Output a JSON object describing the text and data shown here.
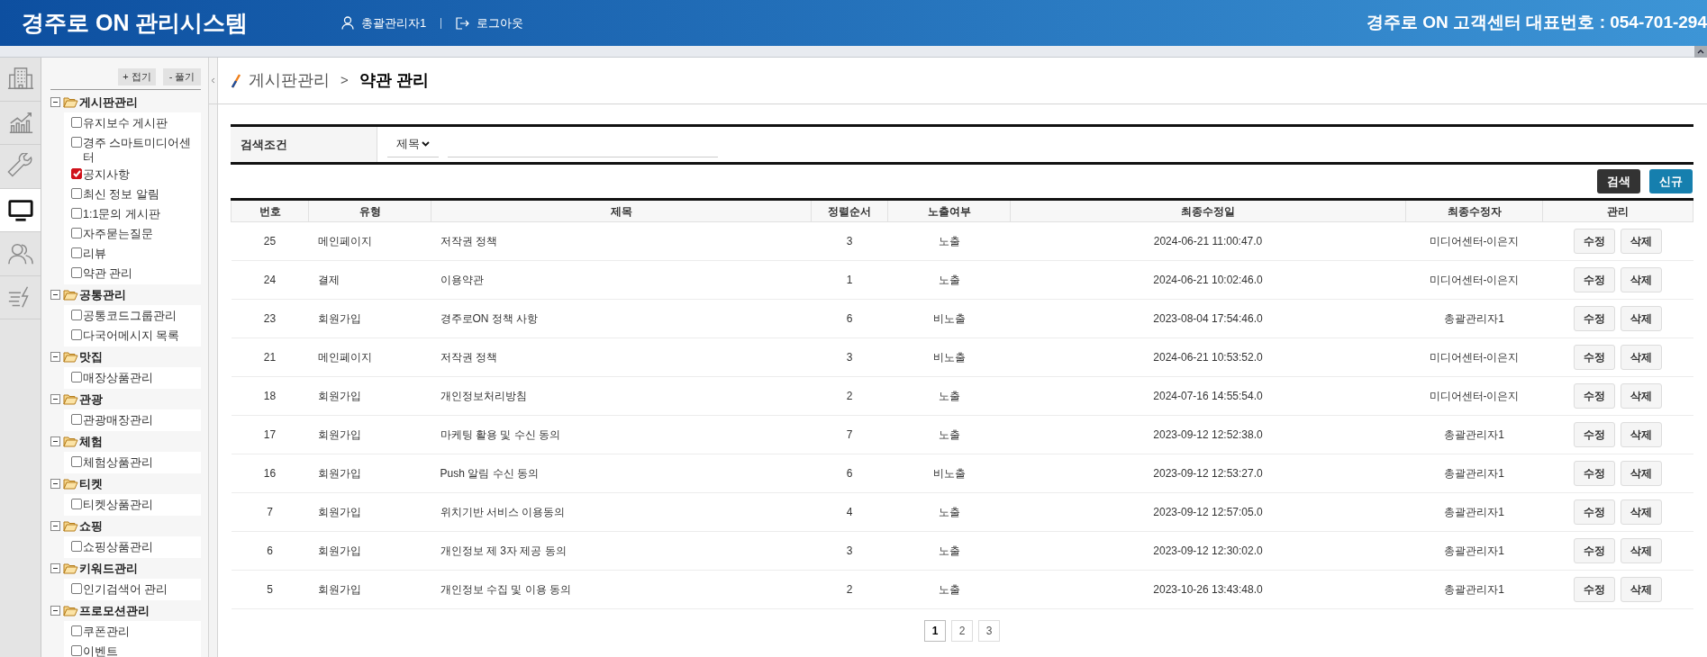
{
  "header": {
    "title": "경주로 ON 관리시스템",
    "user": "총괄관리자1",
    "logout": "로그아웃",
    "contact": "경주로 ON 고객센터 대표번호 : 054-701-294"
  },
  "icon_tabs": [
    {
      "kind": "building",
      "selected": false
    },
    {
      "kind": "chart",
      "selected": false
    },
    {
      "kind": "wrench",
      "selected": false
    },
    {
      "kind": "monitor",
      "selected": true
    },
    {
      "kind": "users",
      "selected": false
    },
    {
      "kind": "lightning",
      "selected": false
    }
  ],
  "tree": {
    "buttons": [
      "+ 접기",
      "- 풀기"
    ],
    "groups": [
      {
        "label": "게시판관리",
        "expanded": true,
        "children": [
          {
            "label": "유지보수 게시판",
            "checked": false
          },
          {
            "label": "경주 스마트미디어센터",
            "checked": false
          },
          {
            "label": "공지사항",
            "checked": true
          },
          {
            "label": "최신 정보 알림",
            "checked": false
          },
          {
            "label": "1:1문의 게시판",
            "checked": false
          },
          {
            "label": "자주묻는질문",
            "checked": false
          },
          {
            "label": "리뷰",
            "checked": false
          },
          {
            "label": "약관 관리",
            "checked": false
          }
        ]
      },
      {
        "label": "공통관리",
        "expanded": true,
        "children": [
          {
            "label": "공통코드그룹관리",
            "checked": false
          },
          {
            "label": "다국어메시지 목록",
            "checked": false
          }
        ]
      },
      {
        "label": "맛집",
        "expanded": true,
        "children": [
          {
            "label": "매장상품관리",
            "checked": false
          }
        ]
      },
      {
        "label": "관광",
        "expanded": true,
        "children": [
          {
            "label": "관광매장관리",
            "checked": false
          }
        ]
      },
      {
        "label": "체험",
        "expanded": true,
        "children": [
          {
            "label": "체험상품관리",
            "checked": false
          }
        ]
      },
      {
        "label": "티켓",
        "expanded": true,
        "children": [
          {
            "label": "티켓상품관리",
            "checked": false
          }
        ]
      },
      {
        "label": "쇼핑",
        "expanded": true,
        "children": [
          {
            "label": "쇼핑상품관리",
            "checked": false
          }
        ]
      },
      {
        "label": "키워드관리",
        "expanded": true,
        "children": [
          {
            "label": "인기검색어 관리",
            "checked": false
          }
        ]
      },
      {
        "label": "프로모션관리",
        "expanded": true,
        "children": [
          {
            "label": "쿠폰관리",
            "checked": false
          },
          {
            "label": "이벤트",
            "checked": false
          }
        ]
      }
    ]
  },
  "breadcrumb": {
    "parent": "게시판관리",
    "separator": ">",
    "current": "약관 관리"
  },
  "search": {
    "label": "검색조건",
    "select": "제목"
  },
  "buttons": [
    {
      "label": "검색",
      "kind": "dark"
    },
    {
      "label": "신규",
      "kind": "primary"
    }
  ],
  "table": {
    "columns": [
      "번호",
      "유형",
      "제목",
      "정렬순서",
      "노출여부",
      "최종수정일",
      "최종수정자",
      "관리"
    ],
    "rows": [
      {
        "cells": [
          "25",
          "메인페이지",
          "저작권 정책",
          "3",
          "노출",
          "2024-06-21 11:00:47.0",
          "미디어센터-이은지"
        ],
        "actions": [
          "수정",
          "삭제"
        ]
      },
      {
        "cells": [
          "24",
          "결제",
          "이용약관",
          "1",
          "노출",
          "2024-06-21 10:02:46.0",
          "미디어센터-이은지"
        ],
        "actions": [
          "수정",
          "삭제"
        ]
      },
      {
        "cells": [
          "23",
          "회원가입",
          "경주로ON 정책 사항",
          "6",
          "비노출",
          "2023-08-04 17:54:46.0",
          "총괄관리자1"
        ],
        "actions": [
          "수정",
          "삭제"
        ]
      },
      {
        "cells": [
          "21",
          "메인페이지",
          "저작권 정책",
          "3",
          "비노출",
          "2024-06-21 10:53:52.0",
          "미디어센터-이은지"
        ],
        "actions": [
          "수정",
          "삭제"
        ]
      },
      {
        "cells": [
          "18",
          "회원가입",
          "개인정보처리방침",
          "2",
          "노출",
          "2024-07-16 14:55:54.0",
          "미디어센터-이은지"
        ],
        "actions": [
          "수정",
          "삭제"
        ]
      },
      {
        "cells": [
          "17",
          "회원가입",
          "마케팅 활용 및 수신 동의",
          "7",
          "노출",
          "2023-09-12 12:52:38.0",
          "총괄관리자1"
        ],
        "actions": [
          "수정",
          "삭제"
        ]
      },
      {
        "cells": [
          "16",
          "회원가입",
          "Push 알림 수신 동의",
          "6",
          "비노출",
          "2023-09-12 12:53:27.0",
          "총괄관리자1"
        ],
        "actions": [
          "수정",
          "삭제"
        ]
      },
      {
        "cells": [
          "7",
          "회원가입",
          "위치기반 서비스 이용동의",
          "4",
          "노출",
          "2023-09-12 12:57:05.0",
          "총괄관리자1"
        ],
        "actions": [
          "수정",
          "삭제"
        ]
      },
      {
        "cells": [
          "6",
          "회원가입",
          "개인정보 제 3자 제공 동의",
          "3",
          "노출",
          "2023-09-12 12:30:02.0",
          "총괄관리자1"
        ],
        "actions": [
          "수정",
          "삭제"
        ]
      },
      {
        "cells": [
          "5",
          "회원가입",
          "개인정보 수집 및 이용 동의",
          "2",
          "노출",
          "2023-10-26 13:43:48.0",
          "총괄관리자1"
        ],
        "actions": [
          "수정",
          "삭제"
        ]
      }
    ]
  },
  "pagination": [
    {
      "label": "1",
      "selected": true
    },
    {
      "label": "2",
      "selected": false
    },
    {
      "label": "3",
      "selected": false
    }
  ]
}
